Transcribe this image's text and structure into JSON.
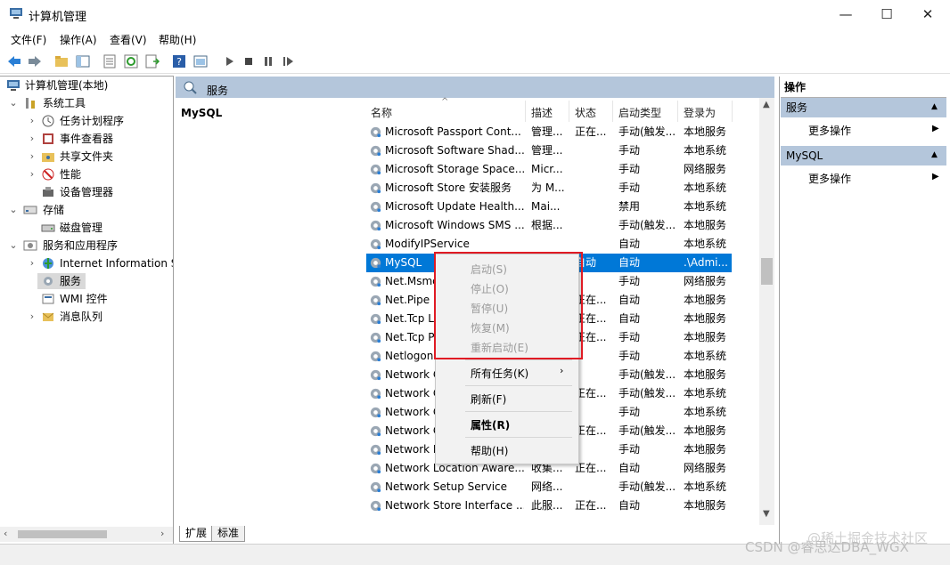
{
  "window": {
    "title": "计算机管理",
    "minimize": "—",
    "maximize": "☐",
    "close": "✕"
  },
  "menu": [
    "文件(F)",
    "操作(A)",
    "查看(V)",
    "帮助(H)"
  ],
  "tree": {
    "root": "计算机管理(本地)",
    "system_tools": "系统工具",
    "task_scheduler": "任务计划程序",
    "event_viewer": "事件查看器",
    "shared_folders": "共享文件夹",
    "performance": "性能",
    "device_manager": "设备管理器",
    "storage": "存储",
    "disk_management": "磁盘管理",
    "services_apps": "服务和应用程序",
    "iis": "Internet Information S",
    "services": "服务",
    "wmi": "WMI 控件",
    "message_queue": "消息队列"
  },
  "center": {
    "header": "服务",
    "selected_title": "MySQL",
    "columns": [
      "名称",
      "描述",
      "状态",
      "启动类型",
      "登录为"
    ],
    "rows": [
      {
        "name": "Microsoft Passport Cont...",
        "desc": "管理...",
        "status": "正在...",
        "startup": "手动(触发...",
        "logon": "本地服务"
      },
      {
        "name": "Microsoft Software Shad...",
        "desc": "管理...",
        "status": "",
        "startup": "手动",
        "logon": "本地系统"
      },
      {
        "name": "Microsoft Storage Space...",
        "desc": "Micr...",
        "status": "",
        "startup": "手动",
        "logon": "网络服务"
      },
      {
        "name": "Microsoft Store 安装服务",
        "desc": "为 M...",
        "status": "",
        "startup": "手动",
        "logon": "本地系统"
      },
      {
        "name": "Microsoft Update Health...",
        "desc": "Mai...",
        "status": "",
        "startup": "禁用",
        "logon": "本地系统"
      },
      {
        "name": "Microsoft Windows SMS ...",
        "desc": "根据...",
        "status": "",
        "startup": "手动(触发...",
        "logon": "本地服务"
      },
      {
        "name": "ModifyIPService",
        "desc": "",
        "status": "",
        "startup": "自动",
        "logon": "本地系统"
      },
      {
        "name": "MySQL",
        "desc": "",
        "status": "自动",
        "startup": "自动",
        "logon": ".\\Admi..."
      },
      {
        "name": "Net.Msmq",
        "desc": "",
        "status": "",
        "startup": "手动",
        "logon": "网络服务"
      },
      {
        "name": "Net.Pipe Li",
        "desc": "",
        "status": "正在...",
        "startup": "自动",
        "logon": "本地服务"
      },
      {
        "name": "Net.Tcp Li",
        "desc": "",
        "status": "正在...",
        "startup": "自动",
        "logon": "本地服务"
      },
      {
        "name": "Net.Tcp Po",
        "desc": "",
        "status": "正在...",
        "startup": "手动",
        "logon": "本地服务"
      },
      {
        "name": "Netlogon",
        "desc": "",
        "status": "",
        "startup": "手动",
        "logon": "本地系统"
      },
      {
        "name": "Network C",
        "desc": "",
        "status": "",
        "startup": "手动(触发...",
        "logon": "本地服务"
      },
      {
        "name": "Network C",
        "desc": "",
        "status": "正在...",
        "startup": "手动(触发...",
        "logon": "本地系统"
      },
      {
        "name": "Network C",
        "desc": "",
        "status": "",
        "startup": "手动",
        "logon": "本地系统"
      },
      {
        "name": "Network C",
        "desc": "",
        "status": "正在...",
        "startup": "手动(触发...",
        "logon": "本地服务"
      },
      {
        "name": "Network L",
        "desc": "",
        "status": "",
        "startup": "手动",
        "logon": "本地服务"
      },
      {
        "name": "Network Location Aware...",
        "desc": "收集...",
        "status": "正在...",
        "startup": "自动",
        "logon": "网络服务"
      },
      {
        "name": "Network Setup Service",
        "desc": "网络...",
        "status": "",
        "startup": "手动(触发...",
        "logon": "本地系统"
      },
      {
        "name": "Network Store Interface ...",
        "desc": "此服...",
        "status": "正在...",
        "startup": "自动",
        "logon": "本地服务"
      }
    ],
    "tabs": [
      "扩展",
      "标准"
    ]
  },
  "context_menu": {
    "start": "启动(S)",
    "stop": "停止(O)",
    "pause": "暂停(U)",
    "resume": "恢复(M)",
    "restart": "重新启动(E)",
    "all_tasks": "所有任务(K)",
    "refresh": "刷新(F)",
    "properties": "属性(R)",
    "help": "帮助(H)"
  },
  "actions": {
    "title": "操作",
    "section1": "服务",
    "more1": "更多操作",
    "section2": "MySQL",
    "more2": "更多操作"
  },
  "watermark": "CSDN @睿思达DBA_WGX",
  "watermark2": "@稀土掘金技术社区",
  "colors": {
    "selection": "#0078d7",
    "header_band": "#b4c6db",
    "highlight_box": "#e01b24"
  }
}
